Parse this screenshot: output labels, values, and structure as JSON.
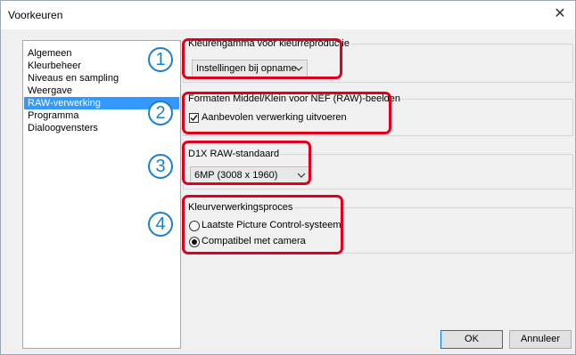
{
  "window": {
    "title": "Voorkeuren"
  },
  "sidebar": {
    "items": [
      {
        "label": "Algemeen",
        "selected": false
      },
      {
        "label": "Kleurbeheer",
        "selected": false
      },
      {
        "label": "Niveaus en sampling",
        "selected": false
      },
      {
        "label": "Weergave",
        "selected": false
      },
      {
        "label": "RAW-verwerking",
        "selected": true
      },
      {
        "label": "Programma",
        "selected": false
      },
      {
        "label": "Dialoogvensters",
        "selected": false
      }
    ]
  },
  "sections": {
    "color_gamut": {
      "badge": "1",
      "title": "Kleurengamma voor kleurreproductie",
      "value": "Instellingen bij opname"
    },
    "nef_formats": {
      "badge": "2",
      "title": "Formaten Middel/Klein voor NEF (RAW)-beelden",
      "checkbox_label": "Aanbevolen verwerking uitvoeren",
      "checked": true
    },
    "d1x_raw": {
      "badge": "3",
      "title": "D1X RAW-standaard",
      "value": "6MP (3008 x 1960)"
    },
    "color_process": {
      "badge": "4",
      "title": "Kleurverwerkingsproces",
      "options": [
        {
          "label": "Laatste Picture Control-systeem",
          "selected": false
        },
        {
          "label": "Compatibel met camera",
          "selected": true
        }
      ]
    }
  },
  "buttons": {
    "ok": "OK",
    "cancel": "Annuleer"
  },
  "colors": {
    "highlight": "#e0001b",
    "badge": "#1e7ec8",
    "selection": "#3399ff"
  }
}
